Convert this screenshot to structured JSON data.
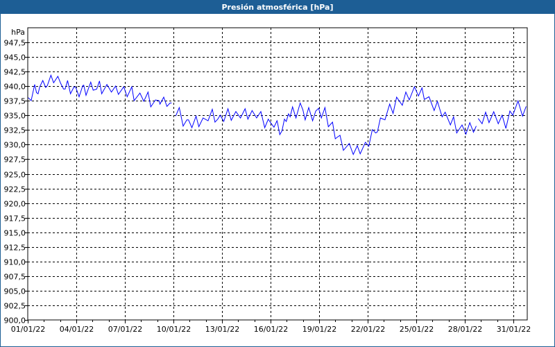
{
  "window": {
    "title": "Presión atmosférica [hPa]"
  },
  "chart_data": {
    "type": "line",
    "title": "Presión atmosférica [hPa]",
    "ylabel": "hPa",
    "xlabel": "",
    "ylim": [
      900,
      950
    ],
    "xlim_days": [
      0,
      30.86
    ],
    "y_ticks": [
      "900,0",
      "902,5",
      "905,0",
      "907,5",
      "910,0",
      "912,5",
      "915,0",
      "917,5",
      "920,0",
      "922,5",
      "925,0",
      "927,5",
      "930,0",
      "932,5",
      "935,0",
      "937,5",
      "940,0",
      "942,5",
      "945,0",
      "947,5"
    ],
    "x_ticks": [
      {
        "day": 0,
        "label": "01/01/22"
      },
      {
        "day": 3,
        "label": "04/01/22"
      },
      {
        "day": 6,
        "label": "07/01/22"
      },
      {
        "day": 9,
        "label": "10/01/22"
      },
      {
        "day": 12,
        "label": "13/01/22"
      },
      {
        "day": 15,
        "label": "16/01/22"
      },
      {
        "day": 18,
        "label": "19/01/22"
      },
      {
        "day": 21,
        "label": "22/01/22"
      },
      {
        "day": 24,
        "label": "25/01/22"
      },
      {
        "day": 27,
        "label": "28/01/22"
      },
      {
        "day": 30,
        "label": "31/01/22"
      }
    ],
    "grid": true,
    "line_color": "#0000ff",
    "series": [
      {
        "name": "Presión atmosférica",
        "segments": [
          [
            [
              0.03,
              938.04
            ],
            [
              0.21,
              937.53
            ],
            [
              0.43,
              940.3
            ],
            [
              0.54,
              938.91
            ],
            [
              0.64,
              938.71
            ],
            [
              0.74,
              939.9
            ],
            [
              0.93,
              940.97
            ],
            [
              1.11,
              939.78
            ],
            [
              1.21,
              940.1
            ],
            [
              1.43,
              941.88
            ],
            [
              1.6,
              940.58
            ],
            [
              1.86,
              941.69
            ],
            [
              2.03,
              940.5
            ],
            [
              2.21,
              939.51
            ],
            [
              2.31,
              939.51
            ],
            [
              2.46,
              940.97
            ],
            [
              2.64,
              938.71
            ],
            [
              2.86,
              939.9
            ],
            [
              2.97,
              939.78
            ],
            [
              3.17,
              938.2
            ],
            [
              3.4,
              940.1
            ],
            [
              3.46,
              940.18
            ],
            [
              3.6,
              938.44
            ],
            [
              3.89,
              940.7
            ],
            [
              4.04,
              939.31
            ],
            [
              4.26,
              939.51
            ],
            [
              4.43,
              940.89
            ],
            [
              4.57,
              938.71
            ],
            [
              4.89,
              940.3
            ],
            [
              5.17,
              938.99
            ],
            [
              5.43,
              940.02
            ],
            [
              5.6,
              938.6
            ],
            [
              5.93,
              939.9
            ],
            [
              6.14,
              938.2
            ],
            [
              6.43,
              939.9
            ],
            [
              6.57,
              937.53
            ],
            [
              6.93,
              938.83
            ],
            [
              7.17,
              937.41
            ],
            [
              7.43,
              938.99
            ],
            [
              7.6,
              936.46
            ],
            [
              7.89,
              937.65
            ],
            [
              8.11,
              937.53
            ],
            [
              8.17,
              936.93
            ],
            [
              8.4,
              938.12
            ],
            [
              8.6,
              936.54
            ],
            [
              8.79,
              937.13
            ],
            [
              8.89,
              937.13
            ]
          ],
          [
            [
              9.14,
              934.88
            ],
            [
              9.36,
              936.34
            ],
            [
              9.6,
              933.17
            ],
            [
              9.83,
              934.24
            ],
            [
              9.93,
              934.24
            ],
            [
              10.14,
              932.9
            ],
            [
              10.4,
              934.88
            ],
            [
              10.57,
              933.06
            ],
            [
              10.83,
              934.56
            ],
            [
              11.14,
              934.08
            ],
            [
              11.4,
              936.06
            ],
            [
              11.57,
              933.85
            ],
            [
              11.74,
              934.36
            ],
            [
              11.89,
              935.03
            ],
            [
              12.11,
              933.97
            ],
            [
              12.37,
              936.14
            ],
            [
              12.57,
              934.16
            ],
            [
              12.86,
              935.67
            ],
            [
              13.14,
              934.56
            ],
            [
              13.43,
              936.14
            ],
            [
              13.6,
              934.36
            ],
            [
              13.86,
              935.83
            ],
            [
              14.14,
              934.56
            ],
            [
              14.4,
              935.67
            ],
            [
              14.64,
              932.9
            ],
            [
              14.86,
              934.36
            ],
            [
              15.0,
              933.77
            ],
            [
              15.21,
              932.98
            ],
            [
              15.4,
              934.08
            ],
            [
              15.43,
              933.77
            ],
            [
              15.57,
              931.71
            ],
            [
              15.71,
              932.38
            ],
            [
              15.86,
              934.36
            ],
            [
              15.97,
              933.97
            ],
            [
              16.11,
              935.27
            ],
            [
              16.21,
              934.76
            ],
            [
              16.36,
              936.46
            ],
            [
              16.57,
              934.56
            ],
            [
              16.83,
              937.13
            ],
            [
              17.0,
              935.95
            ],
            [
              17.14,
              934.24
            ],
            [
              17.36,
              936.34
            ],
            [
              17.6,
              934.08
            ],
            [
              17.79,
              935.75
            ],
            [
              17.97,
              936.22
            ],
            [
              18.14,
              934.56
            ],
            [
              18.36,
              936.34
            ],
            [
              18.57,
              933.06
            ],
            [
              18.83,
              933.85
            ],
            [
              19.0,
              931.0
            ],
            [
              19.14,
              931.31
            ],
            [
              19.29,
              931.59
            ],
            [
              19.5,
              929.02
            ],
            [
              19.86,
              930.2
            ],
            [
              20.11,
              928.31
            ],
            [
              20.36,
              929.81
            ],
            [
              20.54,
              928.42
            ],
            [
              20.86,
              930.4
            ],
            [
              21.07,
              929.73
            ],
            [
              21.29,
              932.58
            ],
            [
              21.5,
              931.99
            ],
            [
              21.6,
              932.18
            ],
            [
              21.79,
              934.56
            ],
            [
              22.07,
              934.24
            ],
            [
              22.36,
              936.93
            ],
            [
              22.57,
              935.35
            ],
            [
              22.79,
              938.12
            ],
            [
              23.14,
              936.73
            ],
            [
              23.36,
              939.0
            ],
            [
              23.57,
              937.65
            ],
            [
              23.89,
              939.9
            ],
            [
              24.14,
              938.32
            ],
            [
              24.36,
              939.71
            ],
            [
              24.5,
              937.73
            ],
            [
              24.79,
              938.2
            ],
            [
              25.11,
              935.83
            ],
            [
              25.31,
              937.41
            ],
            [
              25.6,
              934.76
            ],
            [
              25.79,
              935.55
            ],
            [
              26.11,
              933.37
            ],
            [
              26.31,
              934.76
            ],
            [
              26.5,
              931.99
            ],
            [
              26.83,
              933.37
            ],
            [
              27.07,
              931.79
            ],
            [
              27.31,
              933.77
            ],
            [
              27.54,
              932.11
            ],
            [
              27.71,
              933.18
            ]
          ],
          [
            [
              27.83,
              934.48
            ],
            [
              28.07,
              933.57
            ],
            [
              28.29,
              935.55
            ],
            [
              28.5,
              933.77
            ],
            [
              28.79,
              935.63
            ],
            [
              29.07,
              933.57
            ],
            [
              29.31,
              935.03
            ],
            [
              29.54,
              932.78
            ],
            [
              29.79,
              935.75
            ],
            [
              29.97,
              935.03
            ],
            [
              30.29,
              937.49
            ],
            [
              30.57,
              934.88
            ],
            [
              30.79,
              936.54
            ]
          ]
        ]
      }
    ]
  }
}
